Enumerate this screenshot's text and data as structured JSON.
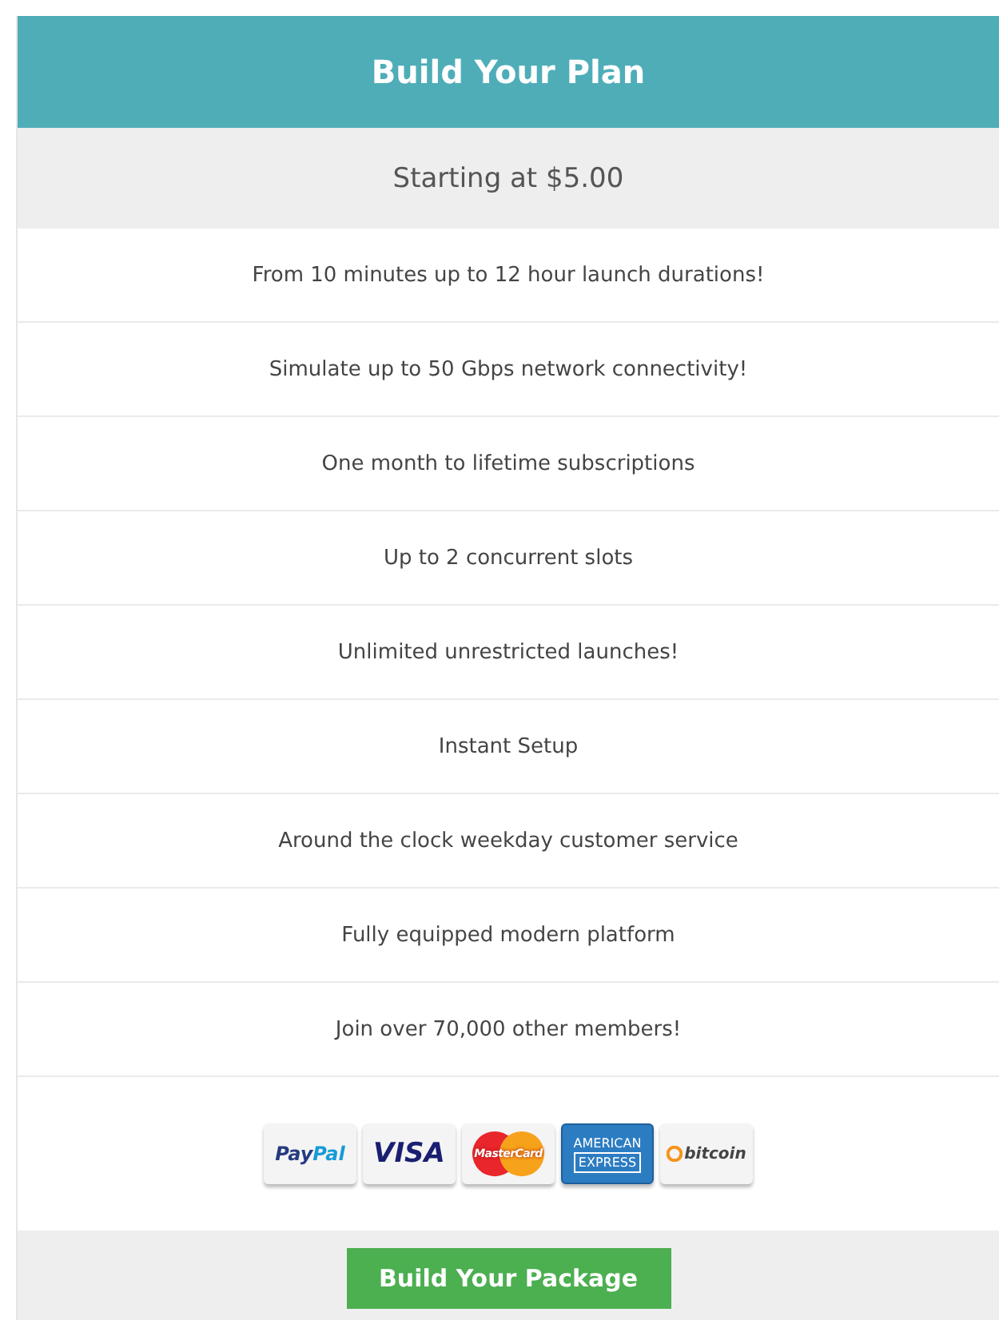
{
  "header": {
    "title": "Build Your Plan"
  },
  "price": "Starting at $5.00",
  "features": [
    "From 10 minutes up to 12 hour launch durations!",
    "Simulate up to 50 Gbps network connectivity!",
    "One month to lifetime subscriptions",
    "Up to 2 concurrent slots",
    "Unlimited unrestricted launches!",
    "Instant Setup",
    "Around the clock weekday customer service",
    "Fully equipped modern platform",
    "Join over 70,000 other members!"
  ],
  "payment_methods": [
    {
      "kind": "paypal",
      "parts": [
        "Pay",
        "Pal"
      ]
    },
    {
      "kind": "visa",
      "parts": [
        "VISA"
      ]
    },
    {
      "kind": "mastercard",
      "parts": [
        "MasterCard"
      ]
    },
    {
      "kind": "amex",
      "parts": [
        "AMERICAN",
        "EXPRESS"
      ]
    },
    {
      "kind": "bitcoin",
      "parts": [
        "bitcoin"
      ]
    }
  ],
  "button": "Build Your Package"
}
